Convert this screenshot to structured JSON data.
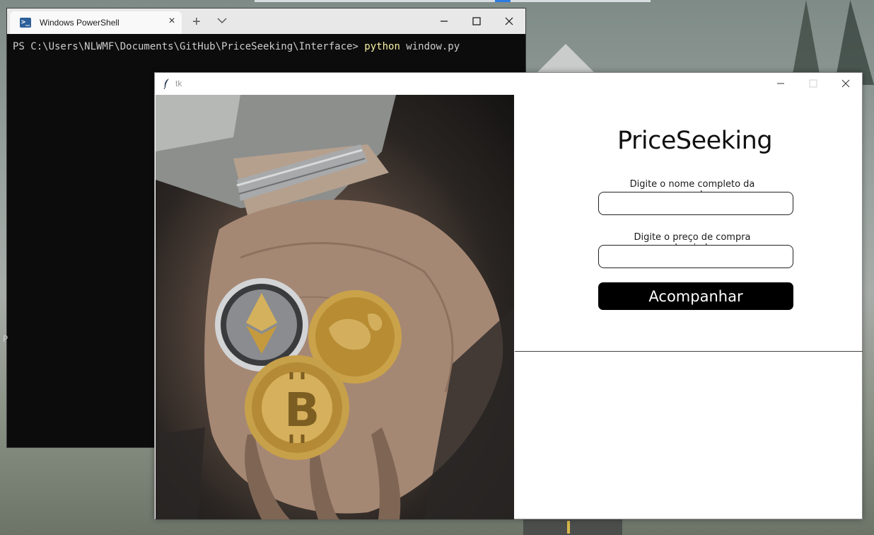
{
  "powershell": {
    "tab_title": "Windows PowerShell",
    "tab_icon": "powershell-icon",
    "prompt": "PS C:\\Users\\NLWMF\\Documents\\GitHub\\PriceSeeking\\Interface> ",
    "command": "python",
    "argument": " window.py",
    "stray_char": "P",
    "new_tab_label": "+"
  },
  "tk": {
    "window_title": "tk",
    "app_title": "PriceSeeking",
    "coin_name_label": "Digite o nome completo da moeda",
    "coin_name_value": "",
    "price_label": "Digite o preço de compra desejado",
    "price_value": "",
    "track_button_label": "Acompanhar"
  },
  "colors": {
    "console_bg": "#0c0c0c",
    "console_text": "#cccccc",
    "console_command": "#f9f1a5",
    "button_bg": "#000000",
    "button_text": "#ffffff"
  }
}
